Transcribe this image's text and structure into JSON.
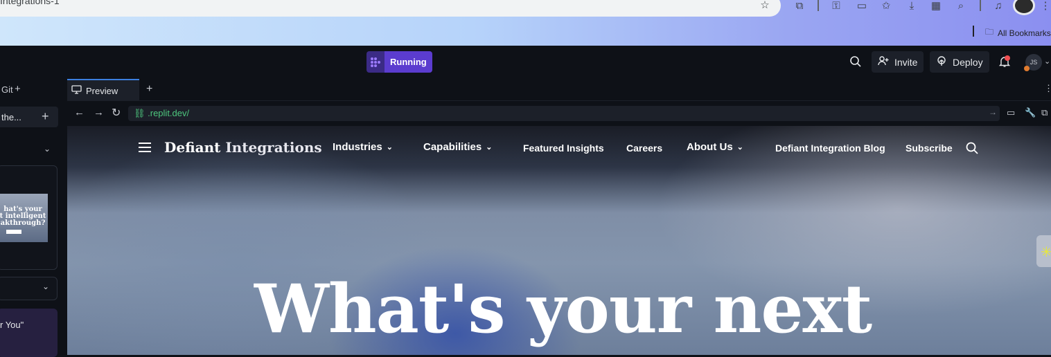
{
  "browser": {
    "tab_title": "Integrations-1",
    "bookmarks_label": "All Bookmarks"
  },
  "replit": {
    "status_label": "Running",
    "invite_label": "Invite",
    "deploy_label": "Deploy",
    "avatar_initials": "JS",
    "left_tab_fragment": "Git",
    "left_item_text": "the...",
    "left_card_text": "r You\"",
    "thumb_line1": "hat's your",
    "thumb_line2": "t intelligent",
    "thumb_line3": "akthrough?",
    "preview_tab_label": "Preview",
    "url": ".replit.dev/"
  },
  "site": {
    "brand_part1": "Defiant",
    "brand_part2": "Integrations",
    "nav": {
      "industries": "Industries",
      "capabilities": "Capabilities",
      "featured": "Featured Insights",
      "careers": "Careers",
      "about": "About Us",
      "blog": "Defiant Integration Blog",
      "subscribe": "Subscribe"
    },
    "hero_line1": "What's your next"
  },
  "colors": {
    "accent_running": "#5b3ccf",
    "url_green": "#4ec77e",
    "notification_dot": "#f04f52"
  }
}
